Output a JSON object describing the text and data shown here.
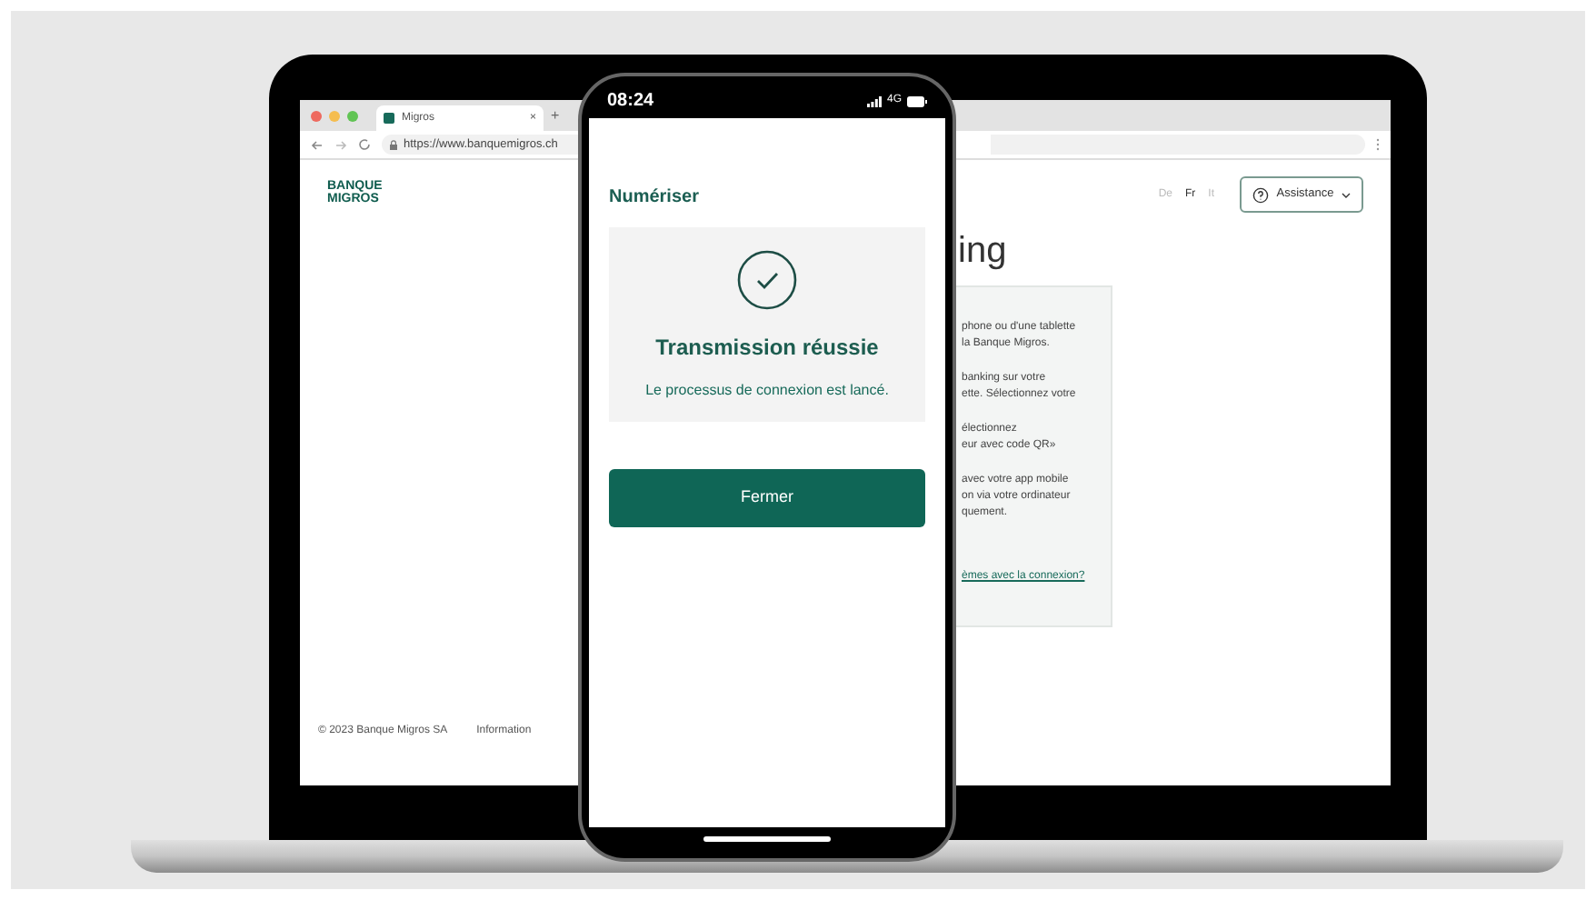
{
  "browser": {
    "tab": {
      "title": "Migros",
      "close": "×",
      "new_tab": "+"
    },
    "url": "https://www.banquemigros.ch"
  },
  "site": {
    "logo": [
      "BANQUE",
      "MIGROS"
    ],
    "languages": [
      {
        "label": "De",
        "selected": false
      },
      {
        "label": "Fr",
        "selected": true
      },
      {
        "label": "It",
        "selected": false
      }
    ],
    "assistance": "Assistance",
    "heading": "ing",
    "card": {
      "paragraphs": [
        [
          "phone ou d'une tablette",
          "la Banque Migros."
        ],
        [
          "banking sur votre",
          "ette. Sélectionnez votre"
        ],
        [
          "électionnez",
          "eur avec code QR»"
        ],
        [
          "avec votre app mobile",
          "on via votre ordinateur",
          "quement."
        ]
      ],
      "link": "èmes avec la connexion?"
    },
    "footer": [
      "© 2023 Banque Migros SA",
      "Information"
    ]
  },
  "phone": {
    "time": "08:24",
    "network": "4G",
    "title": "Numériser",
    "status": {
      "title": "Transmission réussie",
      "message": "Le processus de connexion est lancé."
    },
    "button": "Fermer"
  }
}
